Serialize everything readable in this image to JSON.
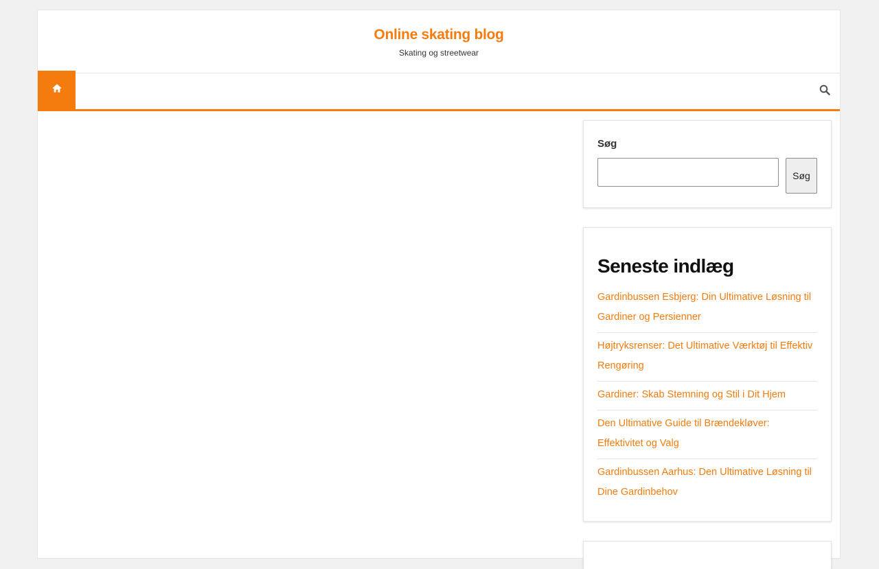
{
  "header": {
    "site_title": "Online skating blog",
    "tagline": "Skating og streetwear"
  },
  "navbar": {
    "home_icon": "home-icon",
    "search_icon": "search-icon"
  },
  "sidebar": {
    "search_widget": {
      "label": "Søg",
      "input_value": "",
      "button_label": "Søg"
    },
    "recent_posts": {
      "title": "Seneste indlæg",
      "items": [
        {
          "label": "Gardinbussen Esbjerg: Din Ultimative Løsning til Gardiner og Persienner"
        },
        {
          "label": "Højtryksrenser: Det Ultimative Værktøj til Effektiv Rengøring"
        },
        {
          "label": "Gardiner: Skab Stemning og Stil i Dit Hjem"
        },
        {
          "label": "Den Ultimative Guide til Brændekløver: Effektivitet og Valg"
        },
        {
          "label": "Gardinbussen Aarhus: Den Ultimative Løsning til Dine Gardinbehov"
        }
      ]
    }
  },
  "colors": {
    "accent": "#f47c0f",
    "background": "#f1f1f1",
    "text": "#333333"
  }
}
